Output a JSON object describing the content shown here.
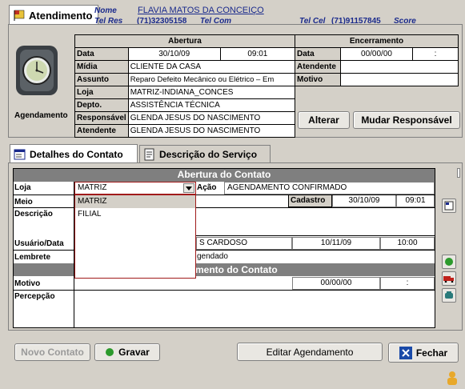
{
  "header": {
    "tab_label": "Atendimento",
    "nome_label": "Nome",
    "nome_value": "FLAVIA MATOS DA CONCEIÇO",
    "telres_label": "Tel Res",
    "telres_value": "(71)32305158",
    "telcom_label": "Tel Com",
    "telcel_label": "Tel Cel",
    "telcel_value": "(71)91157845",
    "score_label": "Score"
  },
  "left_panel": {
    "caption": "Agendamento"
  },
  "abertura": {
    "title": "Abertura",
    "rows": [
      {
        "label": "Data",
        "value": "30/10/09",
        "extra": "09:01"
      },
      {
        "label": "Mídia",
        "value": "CLIENTE DA CASA"
      },
      {
        "label": "Assunto",
        "value": "Reparo Defeito Mecânico ou Elétrico – Em"
      },
      {
        "label": "Loja",
        "value": "MATRIZ-INDIANA_CONCES"
      },
      {
        "label": "Depto.",
        "value": "ASSISTÊNCIA TÉCNICA"
      },
      {
        "label": "Responsável",
        "value": "GLENDA JESUS DO NASCIMENTO"
      },
      {
        "label": "Atendente",
        "value": "GLENDA JESUS DO NASCIMENTO"
      }
    ]
  },
  "encerramento": {
    "title": "Encerramento",
    "data_label": "Data",
    "data_value": "00/00/00",
    "time_value": ":",
    "atendente_label": "Atendente",
    "motivo_label": "Motivo"
  },
  "top_buttons": {
    "alterar": "Alterar",
    "mudar": "Mudar Responsável"
  },
  "tabs": [
    {
      "label": "Detalhes do Contato",
      "icon": "contact-details-icon"
    },
    {
      "label": "Descrição do Serviço",
      "icon": "service-description-icon"
    }
  ],
  "contato": {
    "section_title": "Abertura do Contato",
    "loja_label": "Loja",
    "loja_value": "MATRIZ",
    "acao_label": "Ação",
    "acao_value": "AGENDAMENTO CONFIRMADO",
    "meio_label": "Meio",
    "cadastro_label": "Cadastro",
    "cadastro_date": "30/10/09",
    "cadastro_time": "09:01",
    "descricao_label": "Descrição",
    "usuario_label": "Usuário/Data",
    "usuario_value": "S CARDOSO",
    "usuario_date": "10/11/09",
    "usuario_time": "10:00",
    "lembrete_label": "Lembrete",
    "lembrete_value": "gendado",
    "encerr_section_title": "mento do Contato",
    "motivo_label": "Motivo",
    "motivo_date": "00/00/00",
    "motivo_time": ":",
    "percepcao_label": "Percepção",
    "dropdown_options": [
      "MATRIZ",
      "FILIAL"
    ]
  },
  "bottom_buttons": {
    "novo": "Novo Contato",
    "gravar": "Gravar",
    "editar": "Editar Agendamento",
    "fechar": "Fechar"
  },
  "colors": {
    "accent_blue": "#1a2a8c",
    "section_gray": "#7f7f7f",
    "panel": "#d4d0c8",
    "dropdown_border": "#a01a1a"
  }
}
